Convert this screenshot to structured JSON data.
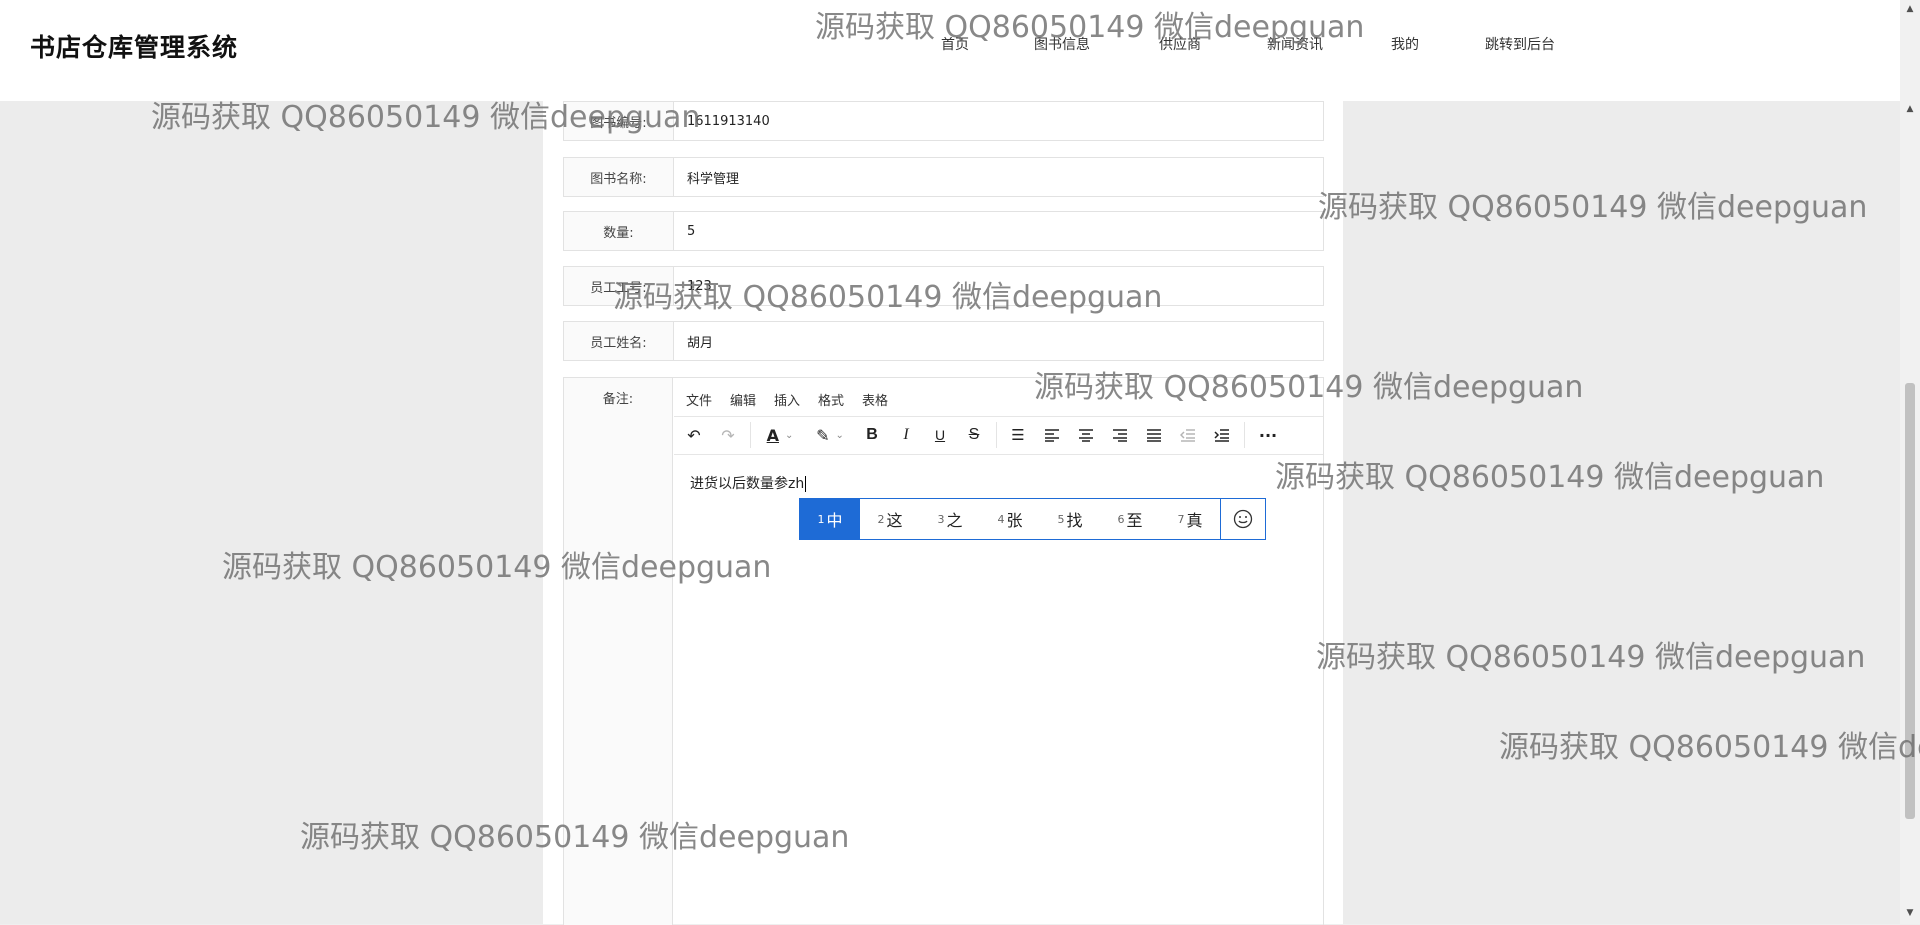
{
  "header": {
    "brand": "书店仓库管理系统",
    "nav": [
      "首页",
      "图书信息",
      "供应商",
      "新闻资讯",
      "我的",
      "跳转到后台"
    ]
  },
  "form": {
    "fields": [
      {
        "label": "图书编号:",
        "value": "1611913140"
      },
      {
        "label": "图书名称:",
        "value": "科学管理"
      },
      {
        "label": "数量:",
        "value": "5"
      },
      {
        "label": "员工工号:",
        "value": "123"
      },
      {
        "label": "员工姓名:",
        "value": "胡月"
      }
    ],
    "remark_label": "备注:"
  },
  "editor": {
    "menu": [
      "文件",
      "编辑",
      "插入",
      "格式",
      "表格"
    ],
    "content": "进货以后数量参zh"
  },
  "ime": {
    "candidates": [
      {
        "num": "1",
        "char": "中"
      },
      {
        "num": "2",
        "char": "这"
      },
      {
        "num": "3",
        "char": "之"
      },
      {
        "num": "4",
        "char": "张"
      },
      {
        "num": "5",
        "char": "找"
      },
      {
        "num": "6",
        "char": "至"
      },
      {
        "num": "7",
        "char": "真"
      }
    ]
  },
  "watermark": "源码获取 QQ86050149 微信deepguan"
}
